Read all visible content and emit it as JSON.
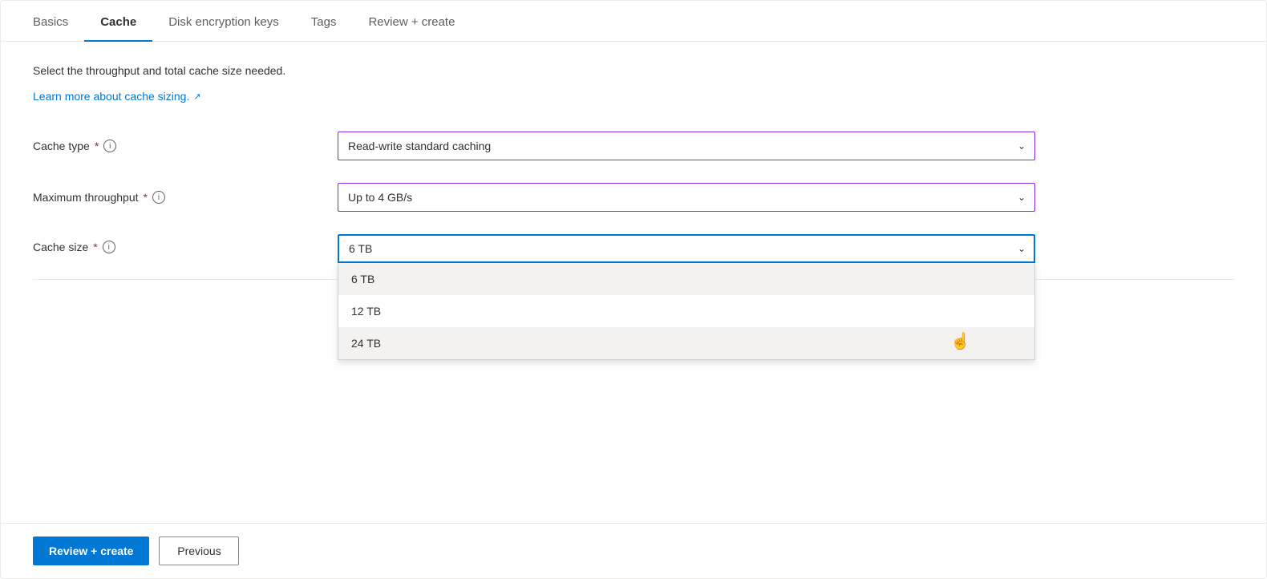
{
  "tabs": [
    {
      "id": "basics",
      "label": "Basics",
      "active": false
    },
    {
      "id": "cache",
      "label": "Cache",
      "active": true
    },
    {
      "id": "disk-encryption",
      "label": "Disk encryption keys",
      "active": false
    },
    {
      "id": "tags",
      "label": "Tags",
      "active": false
    },
    {
      "id": "review-create",
      "label": "Review + create",
      "active": false
    }
  ],
  "description": "Select the throughput and total cache size needed.",
  "learn_link_text": "Learn more about cache sizing.",
  "fields": {
    "cache_type": {
      "label": "Cache type",
      "value": "Read-write standard caching",
      "required": true
    },
    "max_throughput": {
      "label": "Maximum throughput",
      "value": "Up to 4 GB/s",
      "required": true
    },
    "cache_size": {
      "label": "Cache size",
      "value": "6 TB",
      "required": true,
      "options": [
        {
          "value": "6 TB",
          "highlighted": true
        },
        {
          "value": "12 TB",
          "highlighted": false
        },
        {
          "value": "24 TB",
          "highlighted": false
        }
      ]
    }
  },
  "footer": {
    "review_create_label": "Review + create",
    "previous_label": "Previous"
  }
}
